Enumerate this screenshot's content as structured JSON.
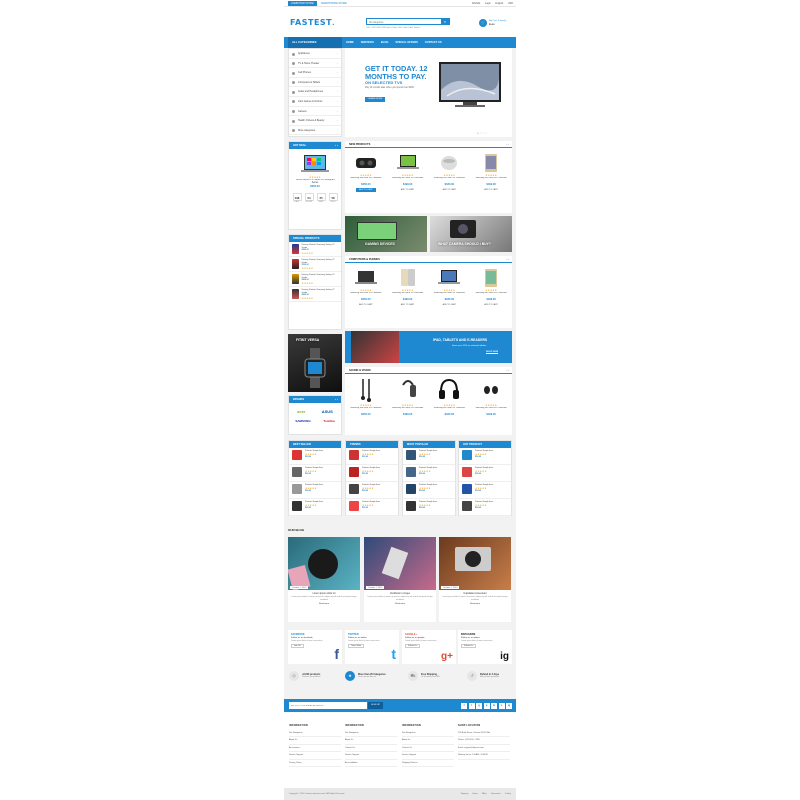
{
  "topbar": {
    "stores": [
      "COMPUTER STORE",
      "SMARTPHONE STORE"
    ],
    "links": [
      "Wishlist",
      "Login",
      "English",
      "USD"
    ]
  },
  "header": {
    "logo_main": "FASTEST",
    "logo_sub": ".",
    "search_placeholder": "All categories",
    "hotline": "Call : 0123 456 789  Find a Store  Gift Card  Order Status",
    "cart_label": "My Cart: 0 item(s)",
    "cart_total": "$0.00"
  },
  "nav": {
    "all_categories": "ALL CATEGORIES",
    "items": [
      "HOME",
      "SERVICES",
      "BLOG",
      "SPECIAL OFFERS",
      "CONTACT US"
    ]
  },
  "categories": [
    "Appliances",
    "TV & Home Theater",
    "Cell Phones",
    "Computers & Tablets",
    "Audio and Headphones",
    "Cars Games & Gizmos",
    "Camera",
    "Health, Fitness & Beauty",
    "More categories"
  ],
  "slider": {
    "heading": "GET IT TODAY. 12 MONTHS TO PAY.",
    "sub": "ON SELECTED TVS",
    "text": "Pay 12 months later when you spend over $199",
    "button": "LEARN MORE"
  },
  "hot_deal": {
    "title": "HOT DEAL",
    "name": "Tencel Stylish PC Tablet PC Designed Series",
    "price": "$250.00",
    "countdown": [
      "498",
      "04",
      "25",
      "58"
    ],
    "countdown_labels": [
      "DAYS",
      "HOURS",
      "MINS",
      "SECS"
    ]
  },
  "new_products": {
    "title": "NEW PRODUCTS",
    "items": [
      {
        "name": "Samsung 360 Gear VR Collection",
        "price": "$250.00",
        "btn": "ADD TO CART"
      },
      {
        "name": "Samsung 360 Gear VR Collection",
        "price": "$499.00",
        "btn": "ADD TO CART"
      },
      {
        "name": "Samsung 360 Gear VR Collection",
        "price": "$180.00",
        "btn": "ADD TO CART"
      },
      {
        "name": "Samsung 360 Gear VR Collection",
        "price": "$499.00",
        "btn": "ADD TO CART"
      }
    ]
  },
  "banners": {
    "gaming": "GAMING DEVICES",
    "camera": "WHAT CAMERA SHOULD I BUY?",
    "tablets": "IPAD, TABLETS AND E-READERS",
    "tablets_sub": "Save up to 50% on selected tablets",
    "tablets_btn": "SHOP NOW",
    "fitness": "FITBIT VERSA"
  },
  "special": {
    "title": "SPECIAL PRODUCTS",
    "items": [
      {
        "name": "Dummy Product Samsung Galaxy J2 Grade",
        "price": "$499.00"
      },
      {
        "name": "Dummy Product Samsung Galaxy J2 Grade",
        "price": "$250.00"
      },
      {
        "name": "Dummy Product Samsung Galaxy J2 Grade",
        "price": "$499.00"
      },
      {
        "name": "Dummy Product Samsung Galaxy J2 Grade",
        "price": "$499.00"
      }
    ]
  },
  "computers": {
    "title": "COMPUTERS & PHONES",
    "items": [
      {
        "name": "Samsung 360 Gear VR Collection",
        "price": "$250.00",
        "btn": "ADD TO CART"
      },
      {
        "name": "Samsung 360 Gear VR Collection",
        "price": "$499.00",
        "btn": "ADD TO CART"
      },
      {
        "name": "Samsung 360 Gear VR Collection",
        "price": "$180.00",
        "btn": "ADD TO CART"
      },
      {
        "name": "Samsung 360 Gear VR Collection",
        "price": "$499.00",
        "btn": "ADD TO CART"
      }
    ]
  },
  "sound": {
    "title": "SOUND & VISION",
    "items": [
      {
        "name": "Samsung 360 Gear VR Collection",
        "price": "$250.00"
      },
      {
        "name": "Samsung 360 Gear VR Collection",
        "price": "$499.00"
      },
      {
        "name": "Samsung 360 Gear VR Collection",
        "price": "$180.00"
      },
      {
        "name": "Samsung 360 Gear VR Collection",
        "price": "$499.00"
      }
    ]
  },
  "brands": {
    "title": "BRANDS",
    "items": [
      "acer",
      "ASUS",
      "SAMSUNG",
      "Toshiba"
    ]
  },
  "lists": [
    {
      "title": "BEST SELLER",
      "item": "Product Simple Item",
      "price": "$99.00"
    },
    {
      "title": "TRENDS",
      "item": "Product Simple Item",
      "price": "$99.00"
    },
    {
      "title": "MOST POPULAR",
      "item": "Product Simple Item",
      "price": "$99.00"
    },
    {
      "title": "HOT PRODUCT",
      "item": "Product Simple Item",
      "price": "$99.00"
    }
  ],
  "blog": {
    "title": "OUR BLOG",
    "posts": [
      {
        "date": "October 7, 2019",
        "title": "Lorem ipsum dolor sit",
        "excerpt": "Lorem ipsum dolor sit amet consectetur adipiscing elit sed do eiusmod tempor incididunt",
        "more": "Read more"
      },
      {
        "date": "October 7, 2019",
        "title": "Vestibulum congue",
        "excerpt": "Lorem ipsum dolor sit amet consectetur adipiscing elit sed do eiusmod tempor incididunt",
        "more": "Read more"
      },
      {
        "date": "October 7, 2019",
        "title": "Cupidatat consectetur",
        "excerpt": "Lorem ipsum dolor sit amet consectetur adipiscing elit sed do eiusmod tempor incididunt",
        "more": "Read more"
      }
    ]
  },
  "social": [
    {
      "network": "FACEBOOK",
      "follow": "Follow us on facebook",
      "desc": "Lorem ipsum dolor sit amet consectetur",
      "btn": "Join Us",
      "icon": "f"
    },
    {
      "network": "TWITTER",
      "follow": "Follow us on twitter",
      "desc": "Lorem ipsum dolor sit amet consectetur",
      "btn": "Tweet Now",
      "icon": "t"
    },
    {
      "network": "GOOGLE +",
      "follow": "Follow us on google",
      "desc": "Lorem ipsum dolor sit amet consectetur",
      "btn": "Follow Us",
      "icon": "g+"
    },
    {
      "network": "INSTAGRAM",
      "follow": "Follow us on twitter",
      "desc": "Lorem ipsum dolor sit amet consectetur",
      "btn": "Follow Us",
      "icon": "ig"
    }
  ],
  "policy": [
    {
      "title": "+8,000 products",
      "sub": "Discover our products"
    },
    {
      "title": "More than 20 Categories",
      "sub": "Lorem ipsum dolor sit"
    },
    {
      "title": "Free Shipping",
      "sub": "On all orders over $99"
    },
    {
      "title": "Refund in 2 days",
      "sub": "Money back guarantee"
    }
  ],
  "newsletter": {
    "placeholder": "ENTER YOUR EMAIL ADDRESS",
    "btn": "SIGN UP",
    "social": [
      "f",
      "t",
      "g",
      "p",
      "in",
      "v",
      "ig"
    ]
  },
  "footer": {
    "cols": [
      {
        "title": "INFORMATION",
        "links": [
          "Site Navigation",
          "About Us",
          "Accessories",
          "Service Support",
          "Privacy Policy"
        ]
      },
      {
        "title": "INFORMATION",
        "links": [
          "Site Navigation",
          "About Us",
          "Contact Us",
          "Service Support",
          "Accessibilities"
        ]
      },
      {
        "title": "INFORMATION",
        "links": [
          "Site Navigation",
          "About Us",
          "Contact Us",
          "Service Support",
          "Shipping Returns"
        ]
      },
      {
        "title": "SHOP LOCATION",
        "links": [
          "298 Bukit Street, Victoria 2020 USA",
          "Phone: (123) 456 - 7890",
          "Email: support@domain.com",
          "Working hours: 7:00AM - 8:00PM"
        ]
      }
    ],
    "copyright": "Copyright © 2019. themes.dunsstar.com® All Rights Reserved",
    "links": [
      "Shipping",
      "Home",
      "FAQs",
      "Information",
      "Cookie"
    ]
  },
  "colors": {
    "accent": "#1e88d0",
    "dark": "#166fb0",
    "star": "#f5a623"
  }
}
